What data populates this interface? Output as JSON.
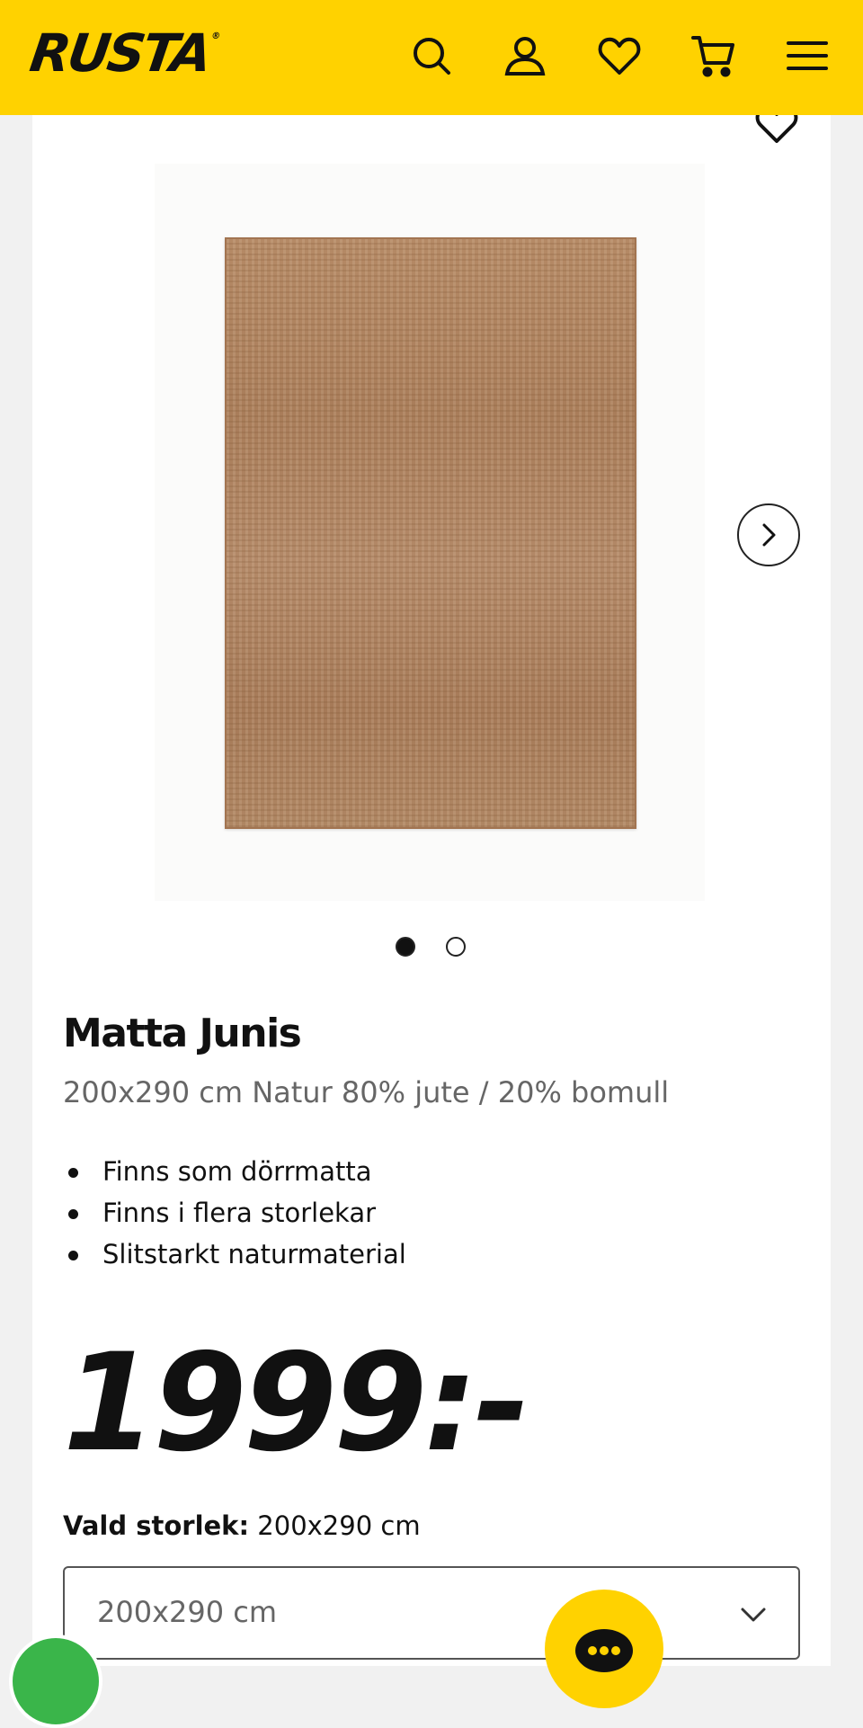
{
  "header": {
    "logo": "RUSTA",
    "logo_mark": "®",
    "icons": [
      "search-icon",
      "account-icon",
      "wishlist-icon",
      "cart-icon",
      "menu-icon"
    ]
  },
  "product": {
    "title": "Matta Junis",
    "subtitle": "200x290 cm Natur 80% jute / 20% bomull",
    "bullets": [
      "Finns som dörrmatta",
      "Finns i flera storlekar",
      "Slitstarkt naturmaterial"
    ],
    "price": "1999:-",
    "image_count": 2,
    "active_image": 1
  },
  "size": {
    "label": "Vald storlek:",
    "value": "200x290 cm",
    "selected_option": "200x290 cm"
  },
  "colors": {
    "brand_yellow": "#ffd200",
    "text": "#111111",
    "muted": "#666666"
  }
}
